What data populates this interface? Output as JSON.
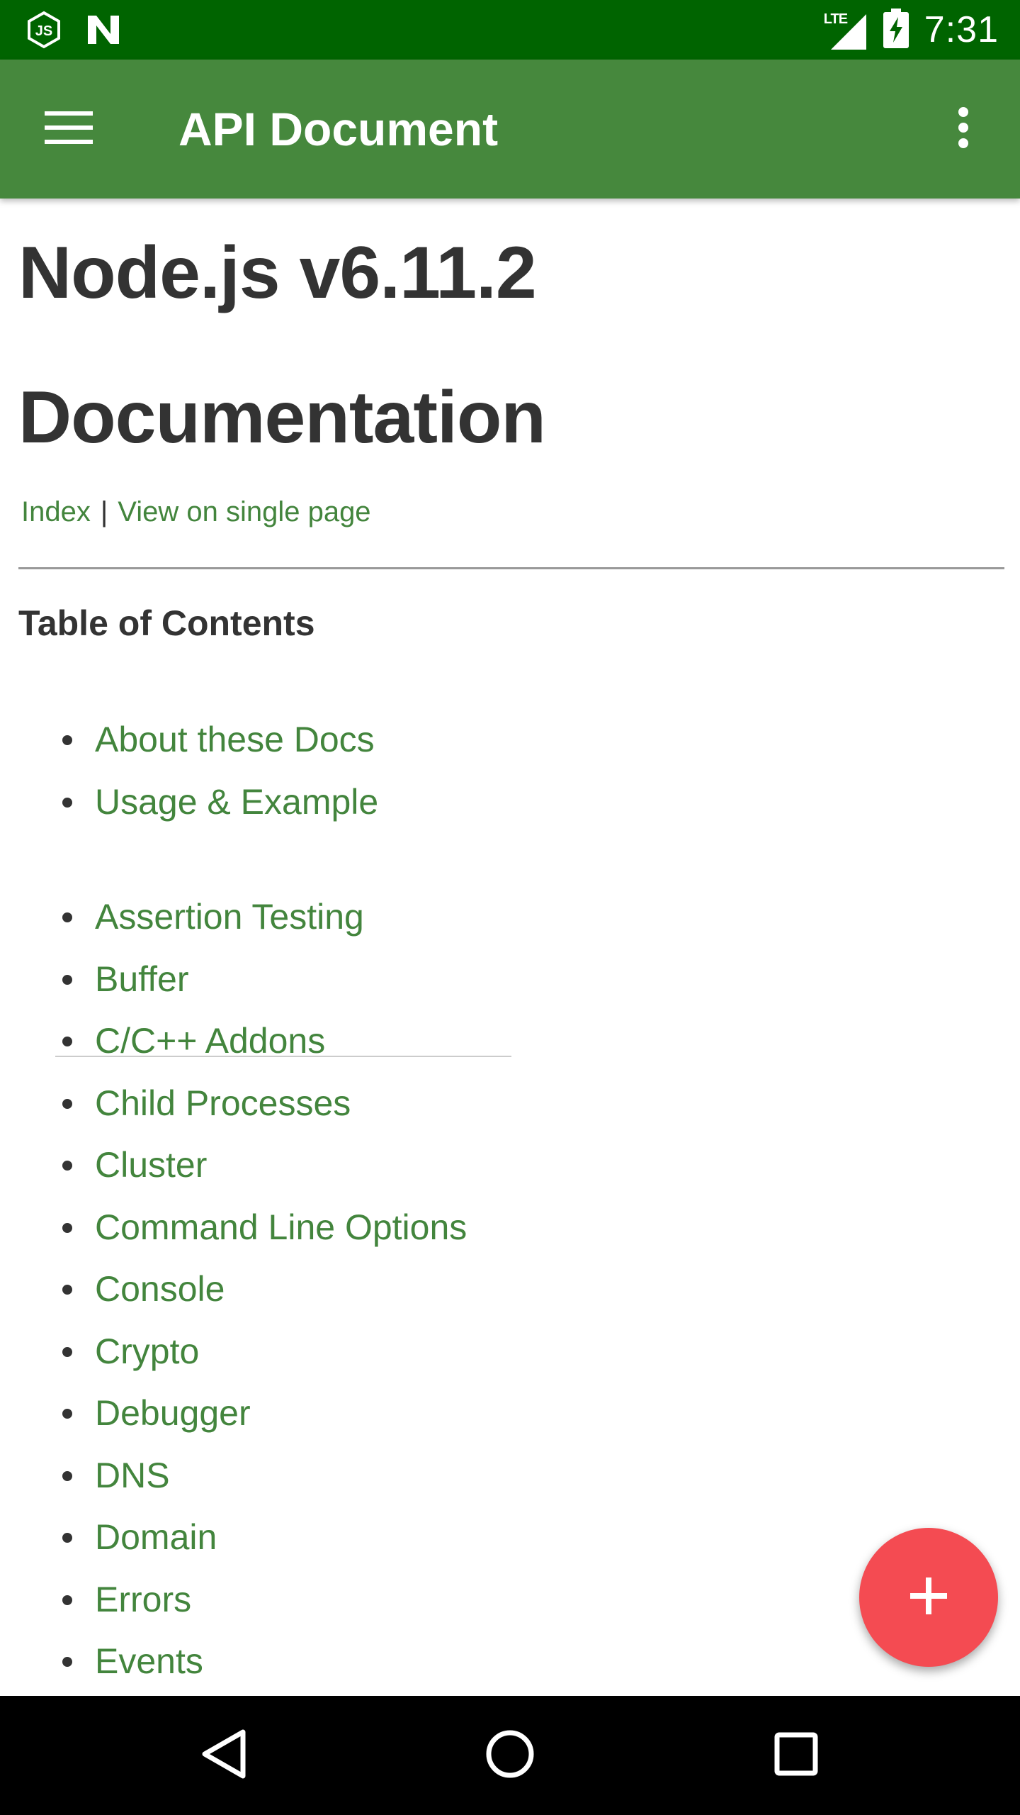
{
  "status_bar": {
    "left_icons": [
      "nodejs-app-icon",
      "n-app-icon"
    ],
    "network_label": "LTE",
    "time": "7:31"
  },
  "app_bar": {
    "title": "API Document",
    "menu_icon": "hamburger-menu-icon",
    "overflow_icon": "more-vertical-icon"
  },
  "doc": {
    "title_line1": "Node.js v6.11.2",
    "title_line2": "Documentation",
    "links": {
      "index": "Index",
      "separator": "|",
      "single_page": "View on single page"
    },
    "toc_heading": "Table of Contents",
    "toc_primary": [
      {
        "label": "About these Docs"
      },
      {
        "label": "Usage & Example"
      }
    ],
    "toc_modules": [
      {
        "label": "Assertion Testing"
      },
      {
        "label": "Buffer"
      },
      {
        "label": "C/C++ Addons"
      },
      {
        "label": "Child Processes"
      },
      {
        "label": "Cluster"
      },
      {
        "label": "Command Line Options"
      },
      {
        "label": "Console"
      },
      {
        "label": "Crypto"
      },
      {
        "label": "Debugger"
      },
      {
        "label": "DNS"
      },
      {
        "label": "Domain"
      },
      {
        "label": "Errors"
      },
      {
        "label": "Events"
      }
    ]
  },
  "fab": {
    "icon": "plus-icon"
  },
  "nav_bar": {
    "icons": [
      "back-triangle-icon",
      "home-circle-icon",
      "recents-square-icon"
    ]
  },
  "colors": {
    "status_bar": "#006400",
    "app_bar": "#46883d",
    "link": "#43853d",
    "heading_text": "#333333",
    "fab": "#f44b52",
    "nav_bar": "#000000"
  }
}
